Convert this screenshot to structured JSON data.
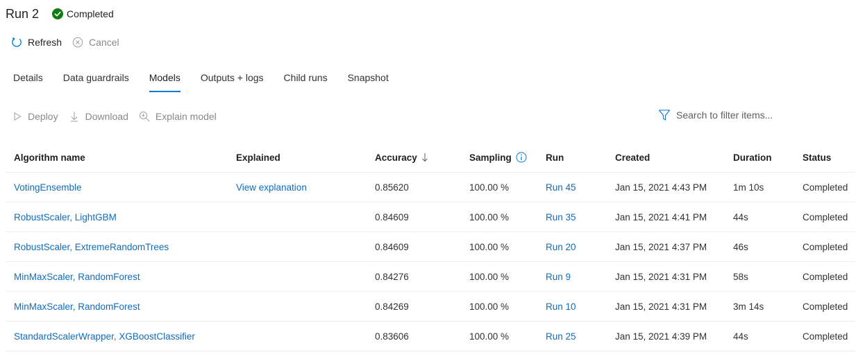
{
  "header": {
    "run_title": "Run 2",
    "status": "Completed",
    "status_color": "#107c10"
  },
  "commands": {
    "refresh": "Refresh",
    "cancel": "Cancel"
  },
  "tabs": [
    {
      "label": "Details",
      "active": false
    },
    {
      "label": "Data guardrails",
      "active": false
    },
    {
      "label": "Models",
      "active": true
    },
    {
      "label": "Outputs + logs",
      "active": false
    },
    {
      "label": "Child runs",
      "active": false
    },
    {
      "label": "Snapshot",
      "active": false
    }
  ],
  "model_toolbar": {
    "deploy": "Deploy",
    "download": "Download",
    "explain": "Explain model",
    "filter_placeholder": "Search to filter items..."
  },
  "table": {
    "columns": {
      "algorithm": "Algorithm name",
      "explained": "Explained",
      "accuracy": "Accuracy",
      "sampling": "Sampling",
      "run": "Run",
      "created": "Created",
      "duration": "Duration",
      "status": "Status"
    },
    "rows": [
      {
        "algorithm": "VotingEnsemble",
        "explained": "View explanation",
        "accuracy": "0.85620",
        "sampling": "100.00 %",
        "run": "Run 45",
        "created": "Jan 15, 2021 4:43 PM",
        "duration": "1m 10s",
        "status": "Completed"
      },
      {
        "algorithm": "RobustScaler, LightGBM",
        "explained": "",
        "accuracy": "0.84609",
        "sampling": "100.00 %",
        "run": "Run 35",
        "created": "Jan 15, 2021 4:41 PM",
        "duration": "44s",
        "status": "Completed"
      },
      {
        "algorithm": "RobustScaler, ExtremeRandomTrees",
        "explained": "",
        "accuracy": "0.84609",
        "sampling": "100.00 %",
        "run": "Run 20",
        "created": "Jan 15, 2021 4:37 PM",
        "duration": "46s",
        "status": "Completed"
      },
      {
        "algorithm": "MinMaxScaler, RandomForest",
        "explained": "",
        "accuracy": "0.84276",
        "sampling": "100.00 %",
        "run": "Run 9",
        "created": "Jan 15, 2021 4:31 PM",
        "duration": "58s",
        "status": "Completed"
      },
      {
        "algorithm": "MinMaxScaler, RandomForest",
        "explained": "",
        "accuracy": "0.84269",
        "sampling": "100.00 %",
        "run": "Run 10",
        "created": "Jan 15, 2021 4:31 PM",
        "duration": "3m 14s",
        "status": "Completed"
      },
      {
        "algorithm": "StandardScalerWrapper, XGBoostClassifier",
        "explained": "",
        "accuracy": "0.83606",
        "sampling": "100.00 %",
        "run": "Run 25",
        "created": "Jan 15, 2021 4:39 PM",
        "duration": "44s",
        "status": "Completed"
      }
    ]
  }
}
